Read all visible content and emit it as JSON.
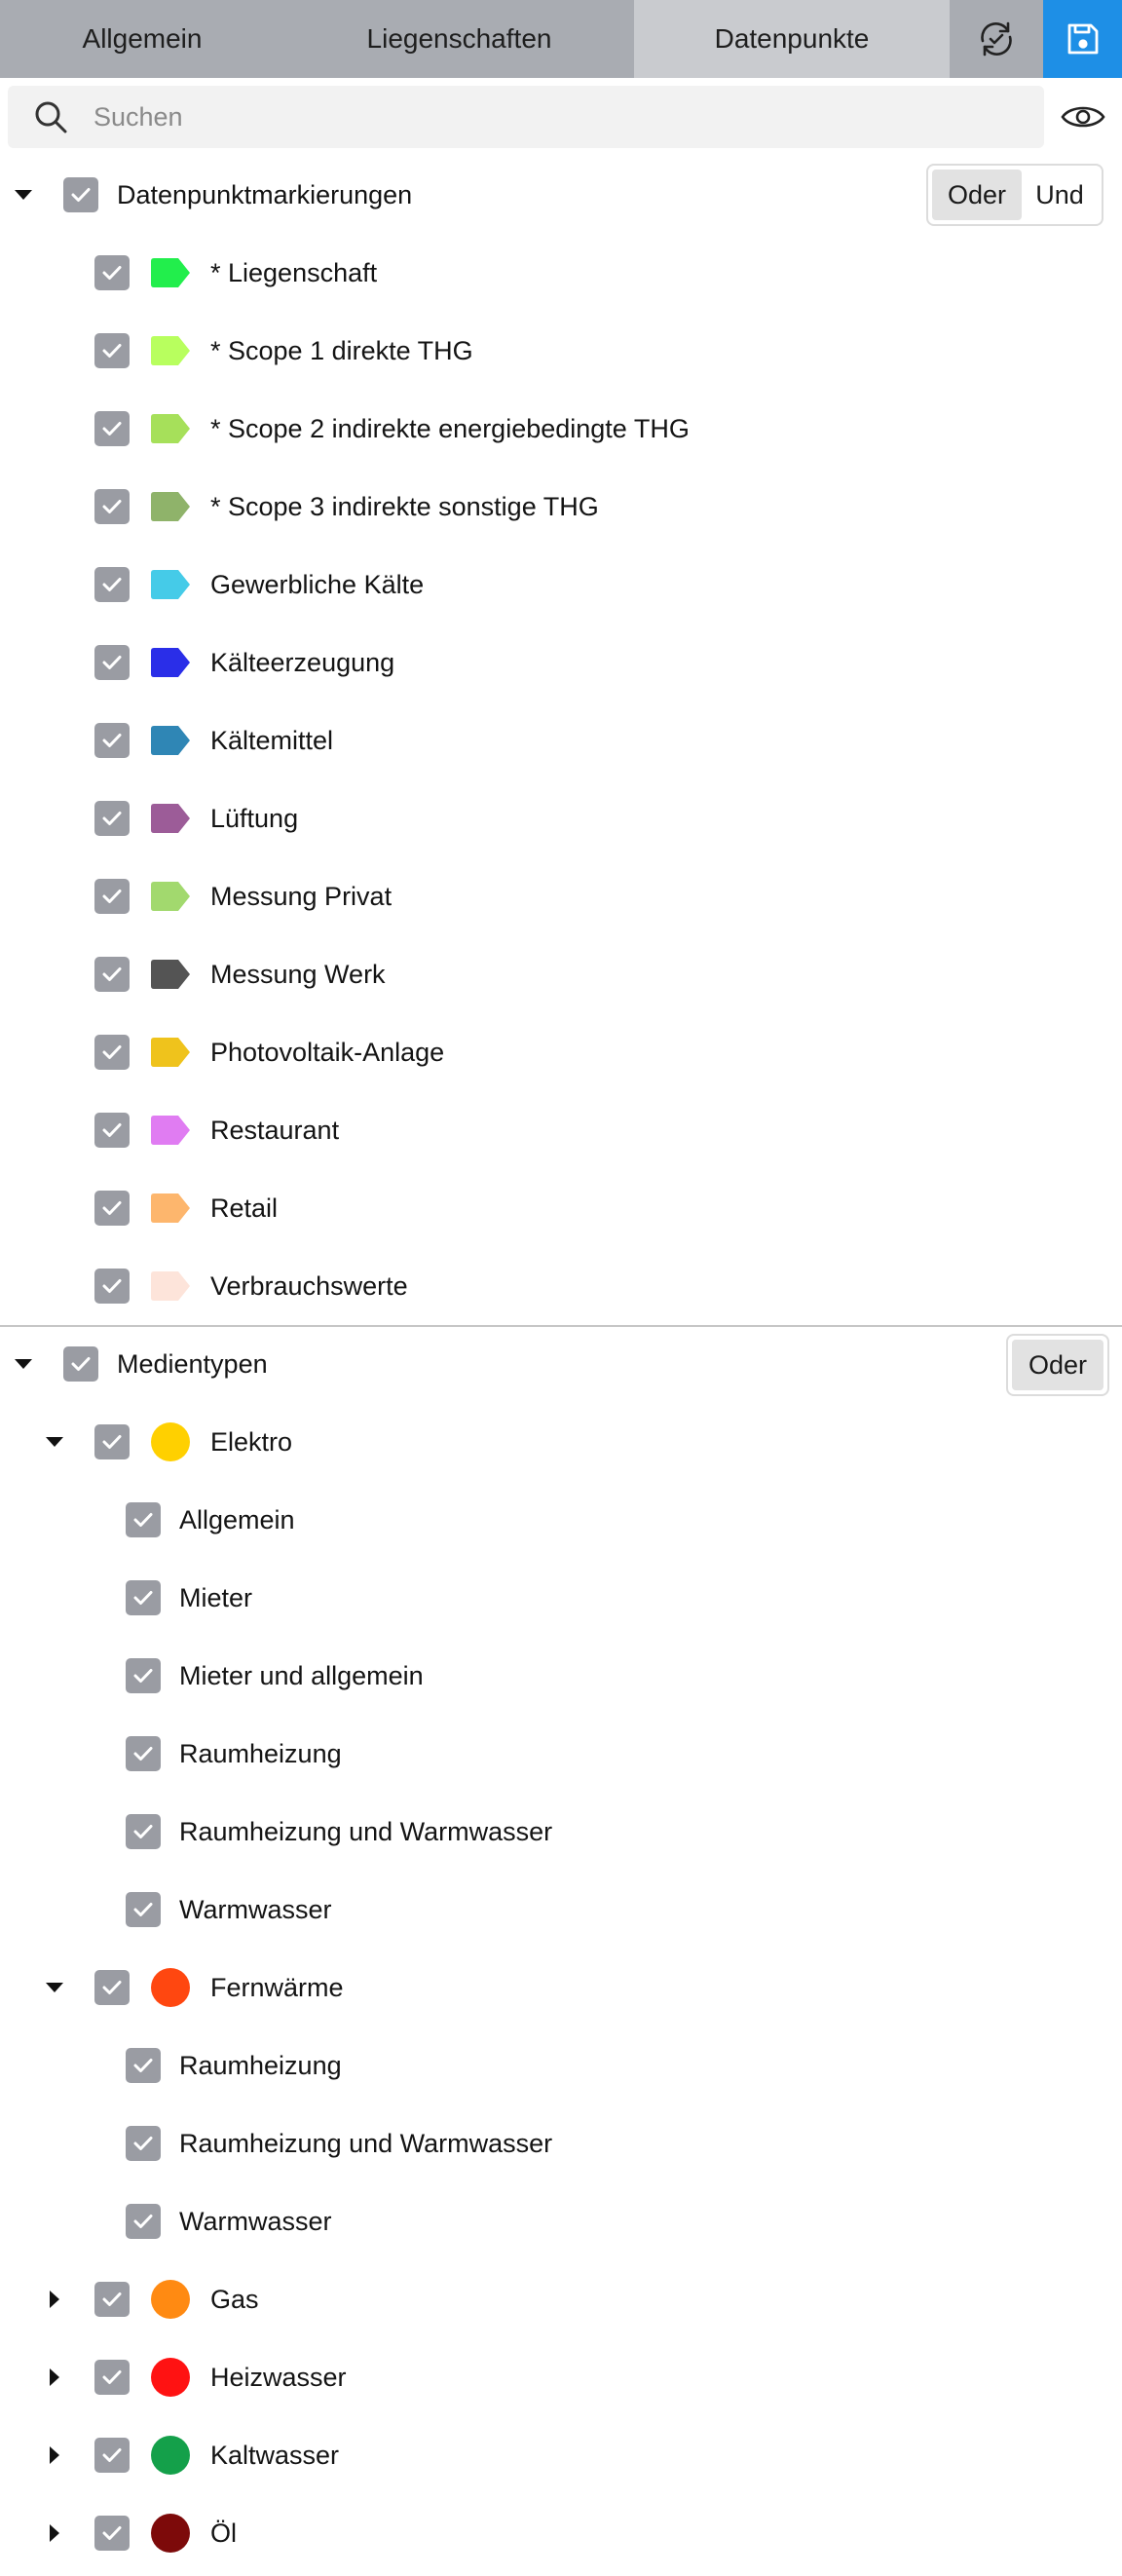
{
  "tabs": {
    "general": "Allgemein",
    "properties": "Liegenschaften",
    "datapoints": "Datenpunkte"
  },
  "search": {
    "placeholder": "Suchen",
    "value": ""
  },
  "tags": {
    "title": "Datenpunktmarkierungen",
    "mode_or": "Oder",
    "mode_and": "Und",
    "items": [
      {
        "label": "* Liegenschaft",
        "color": "#22ee4c"
      },
      {
        "label": "* Scope 1 direkte THG",
        "color": "#b8ff5e"
      },
      {
        "label": "* Scope 2 indirekte energiebedingte THG",
        "color": "#a6e05a"
      },
      {
        "label": "* Scope 3 indirekte sonstige THG",
        "color": "#8fb36a"
      },
      {
        "label": "Gewerbliche Kälte",
        "color": "#45cbe8"
      },
      {
        "label": "Kälteerzeugung",
        "color": "#2a2ee8"
      },
      {
        "label": "Kältemittel",
        "color": "#2f86b5"
      },
      {
        "label": "Lüftung",
        "color": "#9c5c98"
      },
      {
        "label": "Messung Privat",
        "color": "#a2d96e"
      },
      {
        "label": "Messung Werk",
        "color": "#545454"
      },
      {
        "label": "Photovoltaik-Anlage",
        "color": "#efc31c"
      },
      {
        "label": "Restaurant",
        "color": "#e07cf2"
      },
      {
        "label": "Retail",
        "color": "#fdb66d"
      },
      {
        "label": "Verbrauchswerte",
        "color": "#fde4da"
      }
    ]
  },
  "media": {
    "title": "Medientypen",
    "mode_or": "Oder",
    "elektro": {
      "label": "Elektro",
      "color": "#ffd000",
      "children": [
        "Allgemein",
        "Mieter",
        "Mieter und allgemein",
        "Raumheizung",
        "Raumheizung und Warmwasser",
        "Warmwasser"
      ]
    },
    "fernwaerme": {
      "label": "Fernwärme",
      "color": "#ff4710",
      "children": [
        "Raumheizung",
        "Raumheizung und Warmwasser",
        "Warmwasser"
      ]
    },
    "gas": {
      "label": "Gas",
      "color": "#ff8a12"
    },
    "heizwasser": {
      "label": "Heizwasser",
      "color": "#ff1212"
    },
    "kaltwasser": {
      "label": "Kaltwasser",
      "color": "#14a04a"
    },
    "oel": {
      "label": "Öl",
      "color": "#7d0a0a"
    }
  },
  "icons": {
    "sync": "sync-icon",
    "save": "save-icon",
    "search": "search-icon",
    "visibility": "eye-icon",
    "checkbox": "check-icon"
  }
}
